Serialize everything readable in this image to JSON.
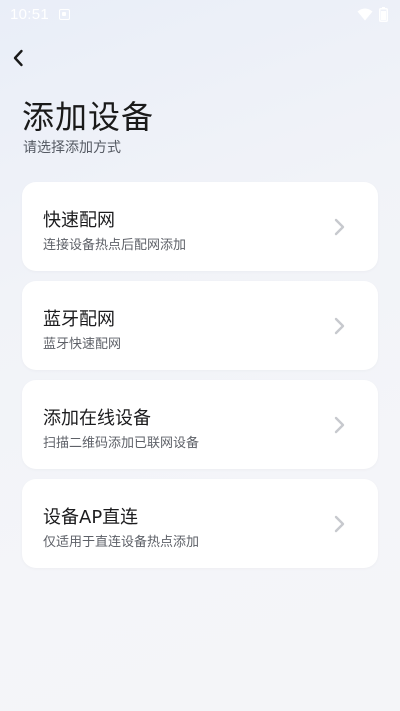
{
  "status_bar": {
    "time": "10:51",
    "icons": [
      "notification-icon",
      "wifi-icon",
      "battery-icon"
    ]
  },
  "header": {
    "back_icon": "chevron-left-icon",
    "title": "添加设备",
    "subtitle": "请选择添加方式"
  },
  "options": [
    {
      "title": "快速配网",
      "description": "连接设备热点后配网添加"
    },
    {
      "title": "蓝牙配网",
      "description": "蓝牙快速配网"
    },
    {
      "title": "添加在线设备",
      "description": "扫描二维码添加已联网设备"
    },
    {
      "title": "设备AP直连",
      "description": "仅适用于直连设备热点添加"
    }
  ],
  "colors": {
    "card_background": "#ffffff",
    "chevron": "#c7c9ce",
    "title_text": "#1c1c1e",
    "secondary_text": "#5e6168"
  }
}
